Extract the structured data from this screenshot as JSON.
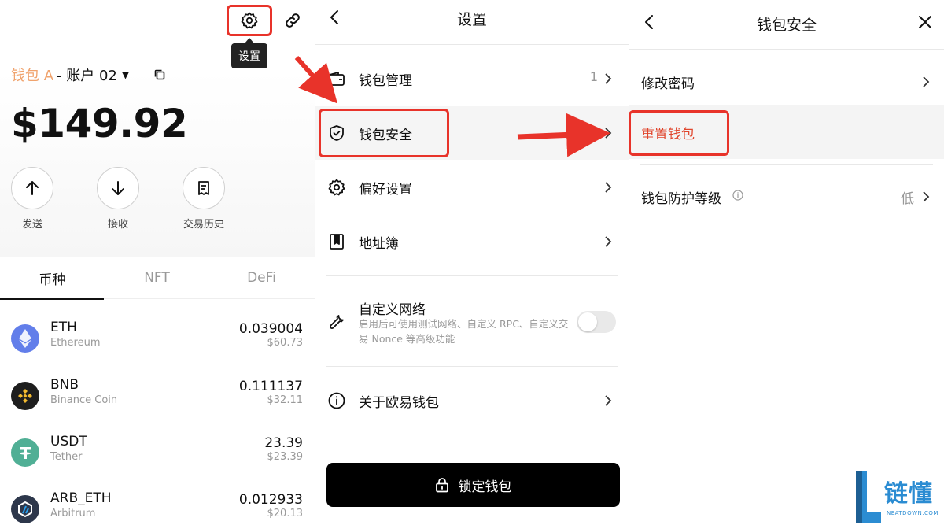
{
  "wallet_panel": {
    "tooltip": "设置",
    "wallet_name": "钱包 A",
    "account_name": "- 账户 02",
    "balance": "$149.92",
    "actions": [
      {
        "label": "发送",
        "icon": "arrow-up-icon"
      },
      {
        "label": "接收",
        "icon": "arrow-down-icon"
      },
      {
        "label": "交易历史",
        "icon": "document-icon"
      }
    ],
    "tabs": [
      "币种",
      "NFT",
      "DeFi"
    ],
    "active_tab": "币种",
    "coins": [
      {
        "symbol": "ETH",
        "name": "Ethereum",
        "amount": "0.039004",
        "usd": "$60.73",
        "color": "#627eea"
      },
      {
        "symbol": "BNB",
        "name": "Binance Coin",
        "amount": "0.111137",
        "usd": "$32.11",
        "color": "#1e1e1e"
      },
      {
        "symbol": "USDT",
        "name": "Tether",
        "amount": "23.39",
        "usd": "$23.39",
        "color": "#50af95"
      },
      {
        "symbol": "ARB_ETH",
        "name": "Arbitrum",
        "amount": "0.012933",
        "usd": "$20.13",
        "color": "#2d374b"
      }
    ]
  },
  "settings_panel": {
    "title": "设置",
    "items": [
      {
        "label": "钱包管理",
        "count": "1",
        "icon": "wallet-icon"
      },
      {
        "label": "钱包安全",
        "icon": "shield-icon"
      },
      {
        "label": "偏好设置",
        "icon": "gear-icon"
      },
      {
        "label": "地址簿",
        "icon": "address-book-icon"
      }
    ],
    "custom_network": {
      "label": "自定义网络",
      "description": "启用后可使用测试网络、自定义 RPC、自定义交易 Nonce 等高级功能",
      "enabled": false
    },
    "about": {
      "label": "关于欧易钱包",
      "icon": "info-icon"
    },
    "lock_button": "锁定钱包"
  },
  "security_panel": {
    "title": "钱包安全",
    "items": [
      {
        "label": "修改密码"
      },
      {
        "label": "重置钱包",
        "color": "#e0452c"
      },
      {
        "label": "钱包防护等级",
        "value": "低"
      }
    ]
  },
  "watermark": {
    "text": "链懂",
    "sub": "NEATDOWN.COM"
  },
  "colors": {
    "highlight_red": "#e8332a",
    "wallet_name_orange": "#f0a36d",
    "watermark_blue": "#2b8cd2"
  }
}
